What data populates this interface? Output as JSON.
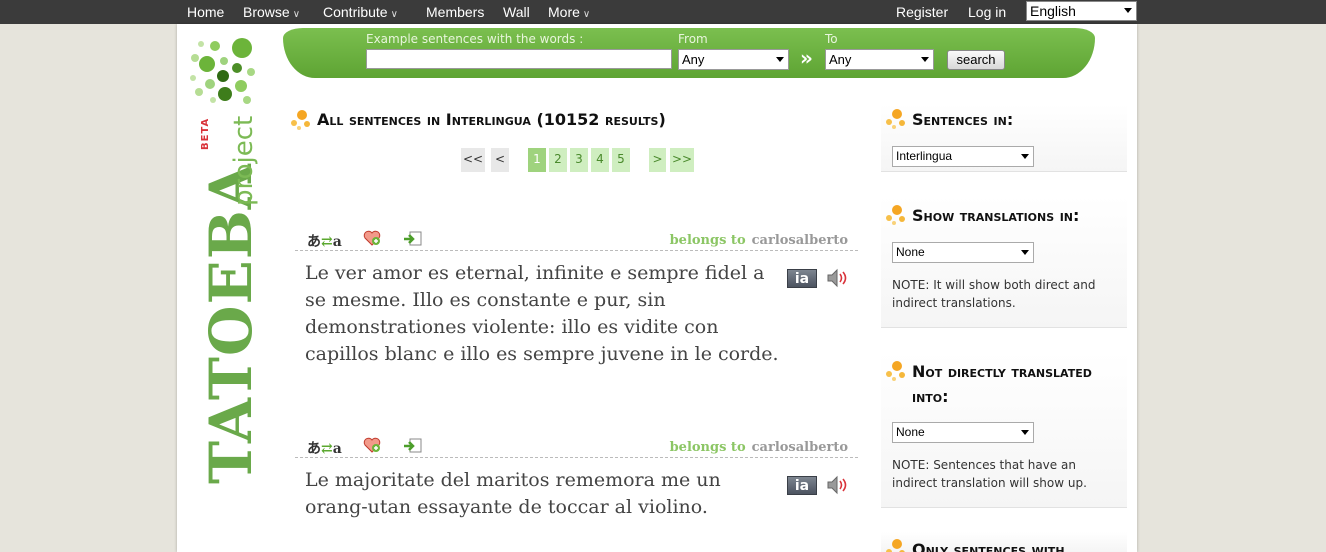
{
  "topnav": {
    "home": "Home",
    "browse": "Browse",
    "contribute": "Contribute",
    "members": "Members",
    "wall": "Wall",
    "more": "More",
    "register": "Register",
    "login": "Log in",
    "language": "English"
  },
  "logo": {
    "title": "TATOEBA",
    "subtitle": "project",
    "beta": "BETA"
  },
  "search": {
    "words_label": "Example sentences with the words :",
    "words_value": "",
    "from_label": "From",
    "from_value": "Any",
    "to_label": "To",
    "to_value": "Any",
    "separator": "»",
    "button": "search"
  },
  "main": {
    "title": "All sentences in Interlingua (10152 results)",
    "pagination": [
      "<<",
      "<",
      "1",
      "2",
      "3",
      "4",
      "5",
      ">",
      ">>"
    ],
    "current_page": "1"
  },
  "sentences": [
    {
      "belongs_label": "belongs to",
      "owner": "carlosalberto",
      "text": "Le ver amor es eternal, infinite e sempre fidel a se mesme. Illo es constante e pur, sin demonstrationes violente: illo es vidite con capillos blanc e illo es sempre juvene in le corde.",
      "lang_code": "ia"
    },
    {
      "belongs_label": "belongs to",
      "owner": "carlosalberto",
      "text": "Le majoritate del maritos rememora me un orang-utan essayante de toccar al violino.",
      "lang_code": "ia"
    }
  ],
  "sidebar": {
    "sentences_in": {
      "title": "Sentences in:",
      "value": "Interlingua"
    },
    "show_translations": {
      "title": "Show translations in:",
      "value": "None",
      "note": "NOTE: It will show both direct and indirect translations."
    },
    "not_translated": {
      "title": "Not directly translated into:",
      "value": "None",
      "note": "NOTE: Sentences that have an indirect translation will show up."
    },
    "only_sentences": {
      "title": "Only sentences with"
    }
  },
  "icons": {
    "transliterate": "transliterate-icon",
    "favorite": "favorite-icon",
    "add_to_list": "add-to-list-icon",
    "audio": "audio-icon",
    "bullet": "bullet-dots-icon"
  },
  "colors": {
    "brand_green": "#6aa94a",
    "search_bar": "#6cb03f",
    "nav_bg": "#3b3b3b",
    "beta_red": "#d9333a"
  }
}
